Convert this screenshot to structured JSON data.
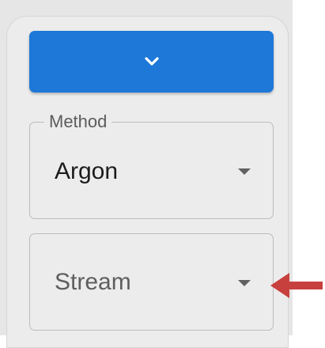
{
  "collapse_button": {
    "icon": "chevron-down-icon"
  },
  "method_select": {
    "label": "Method",
    "value": "Argon",
    "icon": "dropdown-arrow-icon"
  },
  "stream_select": {
    "placeholder": "Stream",
    "icon": "dropdown-arrow-icon"
  },
  "annotation": {
    "icon": "red-arrow-left-icon",
    "color": "#c8403d"
  },
  "colors": {
    "accent": "#1d78d8",
    "panel": "#ececec",
    "backdrop": "#e6e6e6"
  }
}
